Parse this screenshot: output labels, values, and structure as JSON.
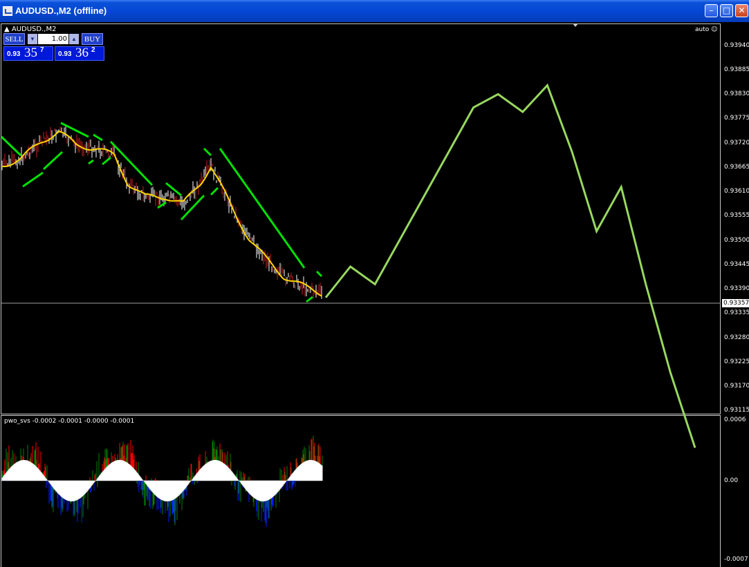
{
  "window": {
    "title": "AUDUSD.,M2 (offline)",
    "minimize_glyph": "–",
    "maximize_glyph": "□",
    "close_glyph": "✕"
  },
  "chart": {
    "symbol_label": "▲ AUDUSD.,M2",
    "auto_label": "auto ☺",
    "current_price": "0.93357",
    "price_axis": [
      "0.93940",
      "0.93885",
      "0.93830",
      "0.93775",
      "0.93720",
      "0.93665",
      "0.93610",
      "0.93555",
      "0.93500",
      "0.93445",
      "0.93390",
      "0.93335",
      "0.93280",
      "0.93225",
      "0.93170",
      "0.93115"
    ]
  },
  "trade_panel": {
    "sell_label": "SELL",
    "buy_label": "BUY",
    "lot_value": "1.00",
    "sell_price_small": "0.93",
    "sell_price_big": "35",
    "sell_price_sup": "7",
    "buy_price_small": "0.93",
    "buy_price_big": "36",
    "buy_price_sup": "2"
  },
  "indicator": {
    "label": "pwo_svs -0.0002 -0.0001 -0.0000 -0.0001",
    "axis": [
      "0.0006",
      "0.00",
      "-0.0007"
    ]
  },
  "colors": {
    "bull_candle": "#cc2020",
    "bear_candle": "#ffffff",
    "ma_yellow": "#ffd700",
    "band_green": "#00e000",
    "forecast": "#98d860",
    "hist_red": "#ff0000",
    "hist_blue": "#0020ff",
    "hist_green": "#008000"
  },
  "chart_data": {
    "type": "line",
    "series": [
      {
        "values": [
          0.9337,
          0.9344,
          0.934,
          0.935,
          0.936,
          0.937,
          0.938,
          0.9383,
          0.9379,
          0.9385,
          0.937,
          0.9352,
          0.9362,
          0.934,
          0.932,
          0.9303
        ]
      }
    ]
  }
}
